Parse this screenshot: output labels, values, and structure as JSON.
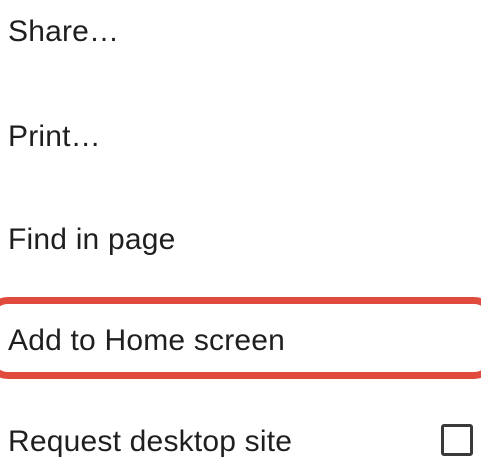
{
  "menu": {
    "items": [
      {
        "label": "Share…"
      },
      {
        "label": "Print…"
      },
      {
        "label": "Find in page"
      },
      {
        "label": "Add to Home screen"
      },
      {
        "label": "Request desktop site"
      }
    ],
    "request_desktop_checked": false,
    "highlight_color": "#e04b3e"
  }
}
